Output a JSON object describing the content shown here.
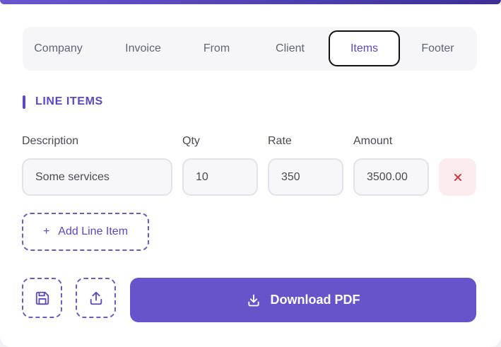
{
  "tabs": [
    {
      "label": "Company"
    },
    {
      "label": "Invoice"
    },
    {
      "label": "From"
    },
    {
      "label": "Client"
    },
    {
      "label": "Items",
      "active": true
    },
    {
      "label": "Footer"
    }
  ],
  "section": {
    "title": "LINE ITEMS"
  },
  "columns": {
    "description": "Description",
    "qty": "Qty",
    "rate": "Rate",
    "amount": "Amount"
  },
  "line_items": [
    {
      "description": "Some services",
      "qty": "10",
      "rate": "350",
      "amount": "3500.00"
    }
  ],
  "actions": {
    "add_line_item": "Add Line Item",
    "add_plus": "+",
    "download_pdf": "Download PDF"
  },
  "icons": {
    "remove": "close-icon",
    "save": "save-icon",
    "upload": "upload-icon",
    "download": "download-icon"
  },
  "colors": {
    "accent": "#5b48c6",
    "button": "#6754cb",
    "remove_bg": "#fdecee",
    "remove_icon": "#d9363e"
  }
}
